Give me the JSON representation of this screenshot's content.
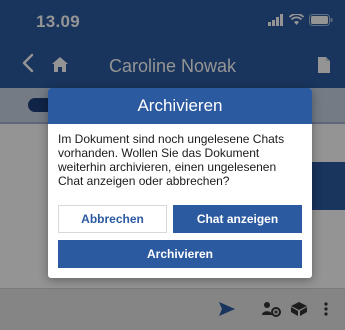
{
  "status_bar": {
    "time": "13.09",
    "icons": [
      "signal-icon",
      "wifi-icon",
      "battery-icon"
    ]
  },
  "nav": {
    "back_icon": "chevron-left-icon",
    "home_icon": "home-icon",
    "title": "Caroline Nowak",
    "doc_icon": "document-icon"
  },
  "bottom_bar": {
    "icons": [
      "send-icon",
      "people-settings-icon",
      "box-settings-icon",
      "more-vertical-icon"
    ]
  },
  "dialog": {
    "title": "Archivieren",
    "message": "Im Dokument sind noch ungelesene Chats vorhanden. Wollen Sie das Dokument weiterhin archivieren, einen ungelesenen Chat anzeigen oder abbrechen?",
    "cancel_label": "Abbrechen",
    "show_chat_label": "Chat anzeigen",
    "archive_label": "Archivieren"
  },
  "colors": {
    "primary": "#2c5aa0",
    "overlay": "rgba(0,0,0,0.42)",
    "bottom_bar": "#e6e6e6"
  }
}
